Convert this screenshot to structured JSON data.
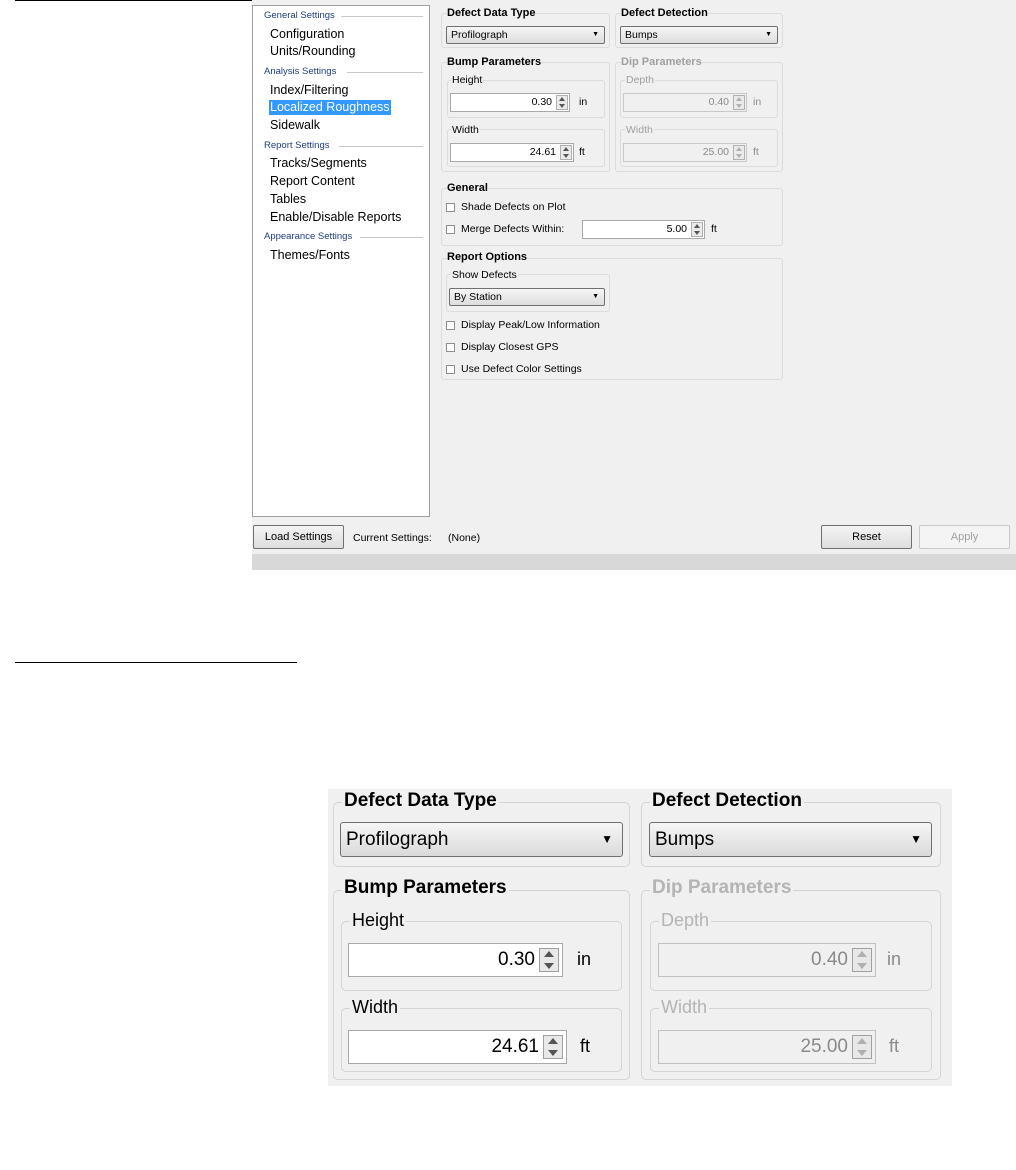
{
  "nav": {
    "sections": [
      {
        "header": "General Settings",
        "items": [
          "Configuration",
          "Units/Rounding"
        ]
      },
      {
        "header": "Analysis Settings",
        "items": [
          "Index/Filtering",
          "Localized Roughness",
          "Sidewalk"
        ]
      },
      {
        "header": "Report Settings",
        "items": [
          "Tracks/Segments",
          "Report Content",
          "Tables",
          "Enable/Disable Reports"
        ]
      },
      {
        "header": "Appearance Settings",
        "items": [
          "Themes/Fonts"
        ]
      }
    ],
    "selected": "Localized Roughness"
  },
  "defect_data_type": {
    "label": "Defect Data Type",
    "value": "Profilograph"
  },
  "defect_detection": {
    "label": "Defect Detection",
    "value": "Bumps"
  },
  "bump": {
    "label": "Bump Parameters",
    "height_label": "Height",
    "height_value": "0.30",
    "height_unit": "in",
    "width_label": "Width",
    "width_value": "24.61",
    "width_unit": "ft"
  },
  "dip": {
    "label": "Dip Parameters",
    "depth_label": "Depth",
    "depth_value": "0.40",
    "depth_unit": "in",
    "width_label": "Width",
    "width_value": "25.00",
    "width_unit": "ft"
  },
  "general": {
    "label": "General",
    "shade_defects": "Shade Defects on Plot",
    "merge_defects": "Merge Defects Within:",
    "merge_value": "5.00",
    "merge_unit": "ft"
  },
  "report_options": {
    "label": "Report Options",
    "show_defects_label": "Show Defects",
    "show_defects_value": "By Station",
    "peak_low": "Display Peak/Low Information",
    "closest_gps": "Display Closest GPS",
    "defect_color": "Use Defect Color Settings"
  },
  "footer": {
    "load_button": "Load Settings",
    "current_settings_label": "Current Settings:",
    "current_settings_value": "(None)",
    "reset_button": "Reset",
    "apply_button": "Apply"
  }
}
